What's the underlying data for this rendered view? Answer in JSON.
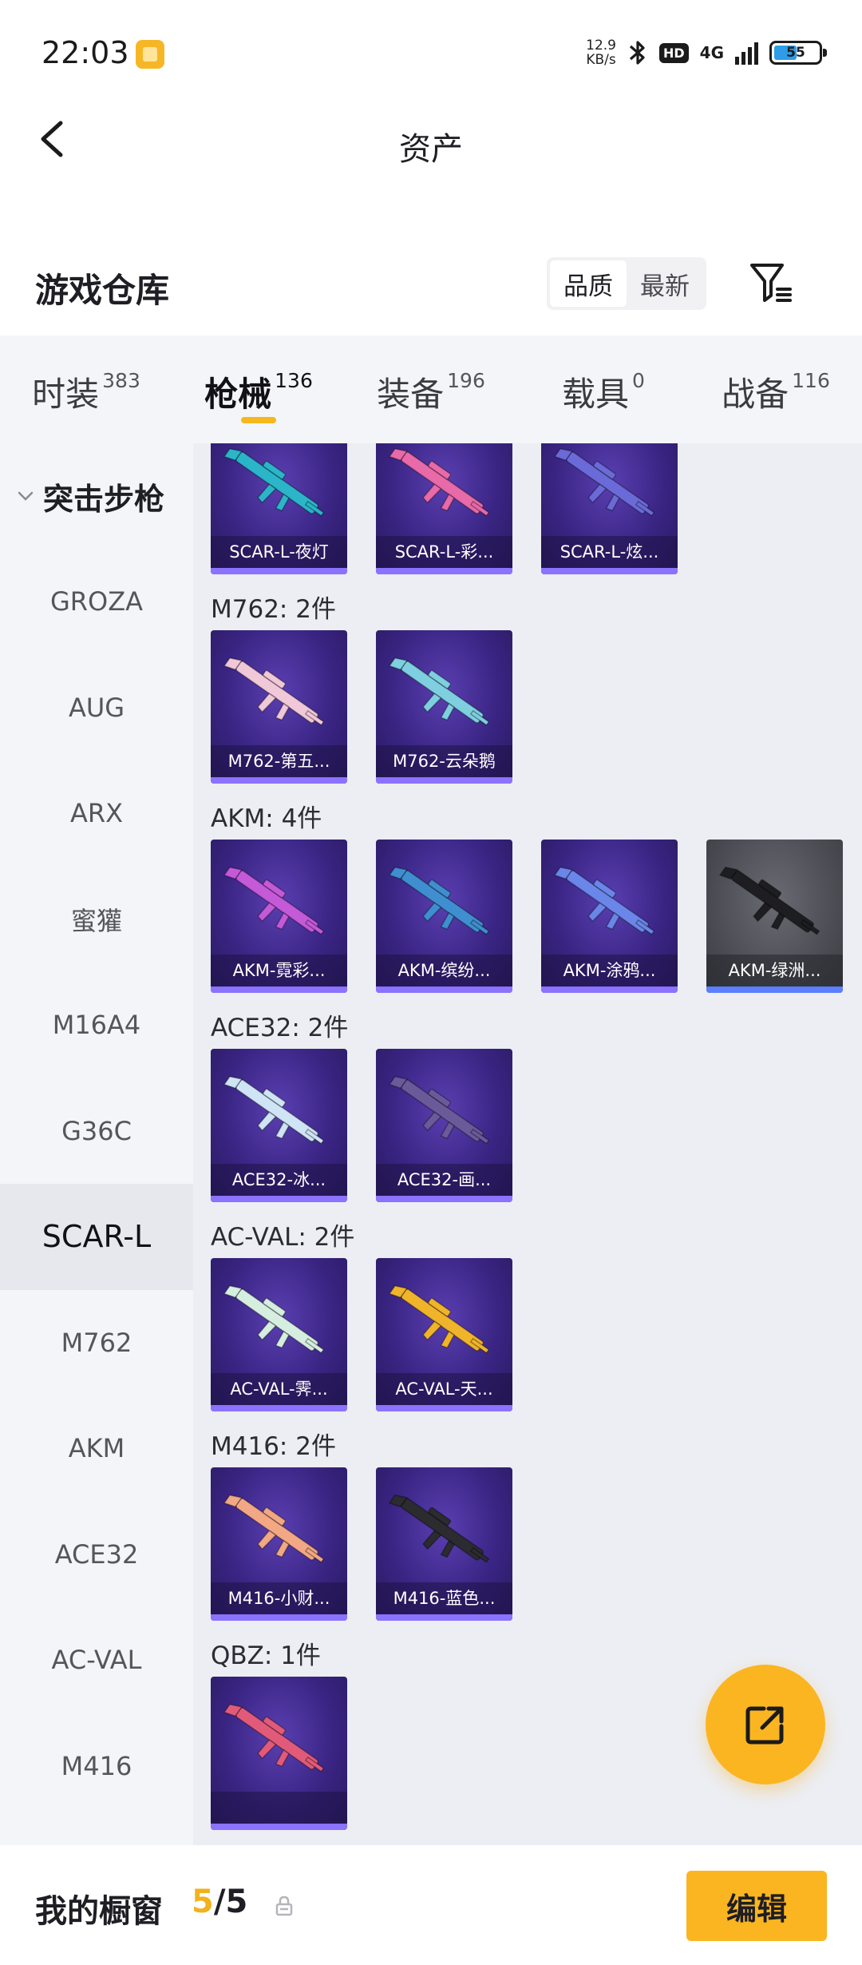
{
  "status_bar": {
    "time": "22:03",
    "speed_value": "12.9",
    "speed_unit": "KB/s",
    "hd": "HD",
    "network": "4G",
    "battery": "55"
  },
  "header": {
    "title": "资产"
  },
  "section": {
    "title": "游戏仓库",
    "sort_options": [
      "品质",
      "最新"
    ],
    "active_sort": "品质"
  },
  "tabs": [
    {
      "label": "时装",
      "count": "383"
    },
    {
      "label": "枪械",
      "count": "136",
      "active": true
    },
    {
      "label": "装备",
      "count": "196"
    },
    {
      "label": "载具",
      "count": "0"
    },
    {
      "label": "战备",
      "count": "116"
    }
  ],
  "sidebar": {
    "group": "突击步枪",
    "items": [
      "GROZA",
      "AUG",
      "ARX",
      "蜜獾",
      "M16A4",
      "G36C",
      "SCAR-L",
      "M762",
      "AKM",
      "ACE32",
      "AC-VAL",
      "M416"
    ],
    "active": "SCAR-L"
  },
  "groups": [
    {
      "label": "",
      "items": [
        {
          "name": "SCAR-L-夜灯",
          "color": "#2bb5c9"
        },
        {
          "name": "SCAR-L-彩...",
          "color": "#e86aa8"
        },
        {
          "name": "SCAR-L-炫...",
          "color": "#6a6ad8"
        }
      ]
    },
    {
      "label": "M762: 2件",
      "items": [
        {
          "name": "M762-第五...",
          "color": "#f0c8d8"
        },
        {
          "name": "M762-云朵鹅",
          "color": "#7ed0e0"
        }
      ]
    },
    {
      "label": "AKM: 4件",
      "items": [
        {
          "name": "AKM-霓彩...",
          "color": "#c45ad8"
        },
        {
          "name": "AKM-缤纷...",
          "color": "#3f8fd0"
        },
        {
          "name": "AKM-涂鸦...",
          "color": "#6a86e8"
        },
        {
          "name": "AKM-绿洲...",
          "color": "#1e1e22",
          "grey": true
        }
      ]
    },
    {
      "label": "ACE32: 2件",
      "items": [
        {
          "name": "ACE32-冰...",
          "color": "#cfe4f5"
        },
        {
          "name": "ACE32-画...",
          "color": "#6b5a9a"
        }
      ]
    },
    {
      "label": "AC-VAL: 2件",
      "items": [
        {
          "name": "AC-VAL-霁...",
          "color": "#d6eee0"
        },
        {
          "name": "AC-VAL-天...",
          "color": "#f0b42a"
        }
      ]
    },
    {
      "label": "M416: 2件",
      "items": [
        {
          "name": "M416-小财...",
          "color": "#f2a884"
        },
        {
          "name": "M416-蓝色...",
          "color": "#2b2b30"
        }
      ]
    },
    {
      "label": "QBZ: 1件",
      "items": [
        {
          "name": "",
          "color": "#e25a7a"
        }
      ]
    }
  ],
  "bottom_bar": {
    "title": "我的橱窗",
    "current": "5",
    "total": "5",
    "edit_label": "编辑"
  }
}
